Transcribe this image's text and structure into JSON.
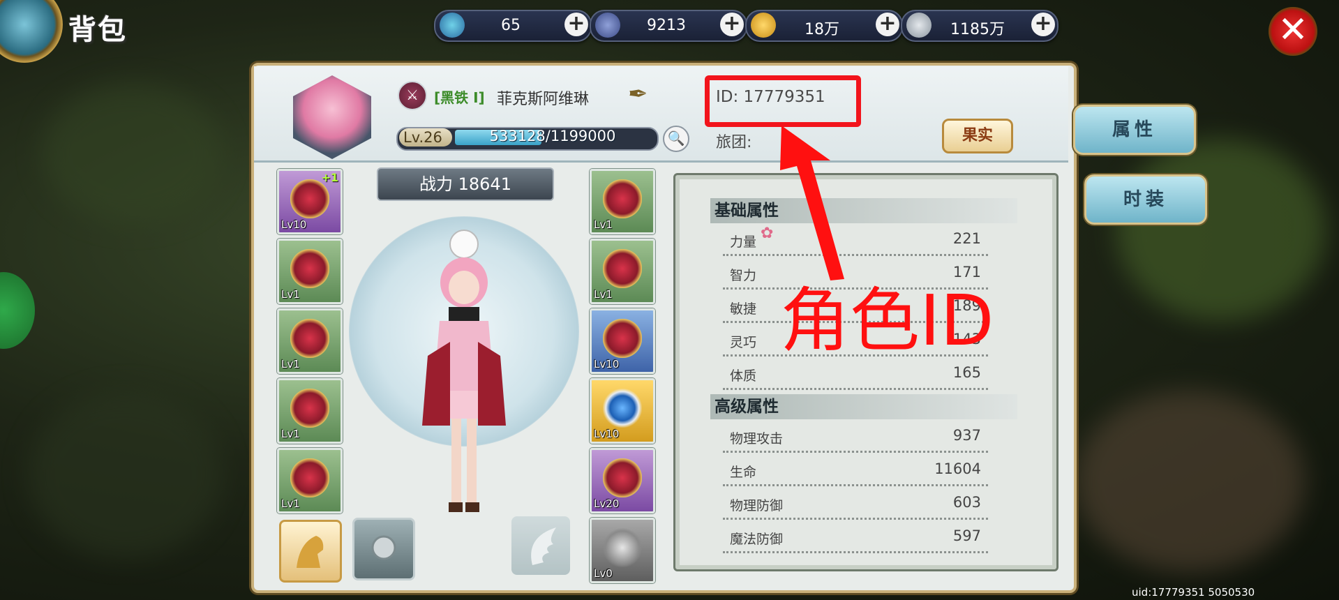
{
  "window": {
    "title": "背包"
  },
  "currencies": [
    {
      "name": "blue-crystal",
      "value": "65",
      "icon": "crystal-icon"
    },
    {
      "name": "locked-crystal",
      "value": "9213",
      "icon": "locked-crystal-icon"
    },
    {
      "name": "gold-coin",
      "value": "18万",
      "icon": "gold-coin-icon"
    },
    {
      "name": "silver-coin",
      "value": "1185万",
      "icon": "silver-coin-icon"
    }
  ],
  "currency_plus_label": "+",
  "close_label": "✕",
  "profile": {
    "rank_label": "[黑铁 I]",
    "name": "菲克斯阿维琳",
    "id_text": "ID:  17779351",
    "level": "Lv.26",
    "exp_text": "533128/1199000",
    "exp_fraction": 0.4446,
    "guild_label": "旅团:",
    "fruit_button": "果实"
  },
  "tabs": [
    {
      "label": "属性"
    },
    {
      "label": "时装"
    }
  ],
  "combat_power": "战力 18641",
  "equipment_left": [
    {
      "lv": "Lv10",
      "plus": "+1",
      "rarity": "purple"
    },
    {
      "lv": "Lv1",
      "rarity": "green"
    },
    {
      "lv": "Lv1",
      "rarity": "green"
    },
    {
      "lv": "Lv1",
      "rarity": "green"
    },
    {
      "lv": "Lv1",
      "rarity": "green"
    }
  ],
  "equipment_right": [
    {
      "lv": "Lv1",
      "rarity": "green"
    },
    {
      "lv": "Lv1",
      "rarity": "green"
    },
    {
      "lv": "Lv10",
      "rarity": "blue"
    },
    {
      "lv": "Lv10",
      "rarity": "gold"
    },
    {
      "lv": "Lv20",
      "rarity": "purple"
    },
    {
      "lv": "Lv0",
      "rarity": "grey"
    }
  ],
  "stats": {
    "basic_header": "基础属性",
    "basic": [
      {
        "name": "力量",
        "value": "221"
      },
      {
        "name": "智力",
        "value": "171"
      },
      {
        "name": "敏捷",
        "value": "189"
      },
      {
        "name": "灵巧",
        "value": "143"
      },
      {
        "name": "体质",
        "value": "165"
      }
    ],
    "advanced_header": "高级属性",
    "advanced": [
      {
        "name": "物理攻击",
        "value": "937"
      },
      {
        "name": "生命",
        "value": "11604"
      },
      {
        "name": "物理防御",
        "value": "603"
      },
      {
        "name": "魔法防御",
        "value": "597"
      }
    ]
  },
  "annotation": {
    "label": "角色ID",
    "color": "#ff1010"
  },
  "footer": {
    "uid": "uid:17779351 5050530"
  }
}
